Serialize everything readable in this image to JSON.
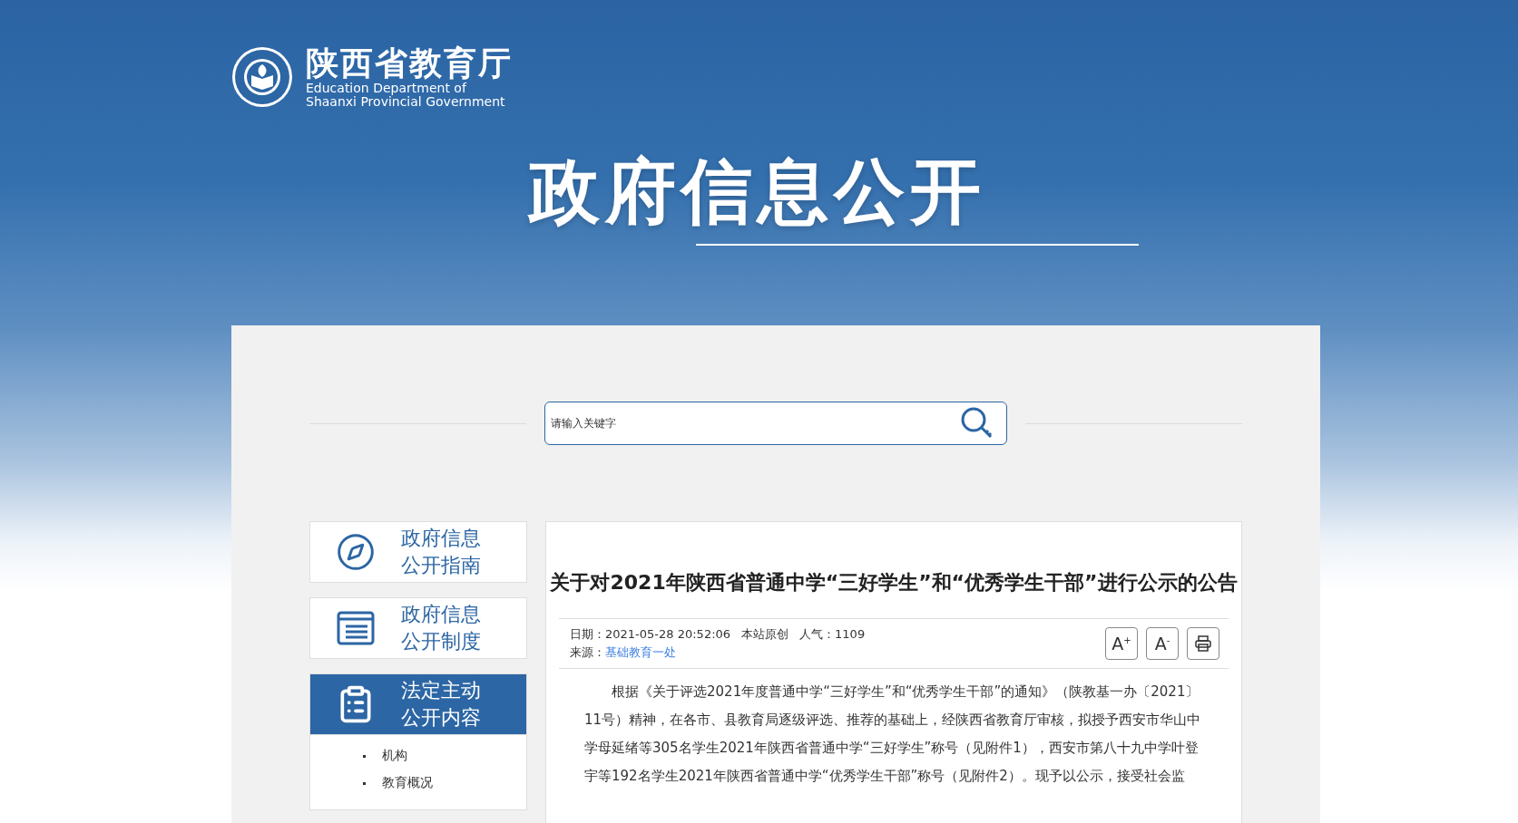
{
  "site": {
    "name": "陕西省教育厅",
    "name_en": [
      "Education Department of",
      "Shaanxi Provincial Government"
    ]
  },
  "banner_title": "政府信息公开",
  "search": {
    "placeholder": "请输入关键字"
  },
  "sidebar": {
    "items": [
      {
        "label": "政府信息公开指南",
        "kind": "compass",
        "selected": false
      },
      {
        "label": "政府信息公开制度",
        "kind": "list",
        "selected": false
      },
      {
        "label": "法定主动公开内容",
        "kind": "clipboard",
        "selected": true
      }
    ],
    "subitems": [
      "机构",
      "教育概况"
    ]
  },
  "article": {
    "title": "关于对2021年陕西省普通中学“三好学生”和“优秀学生干部”进行公示的公告",
    "meta": {
      "date_label": "日期：",
      "date": "2021-05-28 20:52:06",
      "origin": "本站原创",
      "views_label": "人气：",
      "views": "1109",
      "source_label": "来源：",
      "source": "基础教育一处"
    },
    "tools": [
      {
        "kind": "font",
        "label": "A$^{+}$"
      },
      {
        "kind": "font",
        "label": "A$^{-}$"
      },
      {
        "kind": "print"
      }
    ],
    "body": "根据《关于评选2021年度普通中学“三好学生”和“优秀学生干部”的通知》（陕教基一办〔2021〕11号）精神，在各市、县教育局逐级评选、推荐的基础上，经陕西省教育厅审核，拟授予西安市华山中学母延绪等305名学生2021年陕西省普通中学“三好学生”称号（见附件1），西安市第八十九中学叶登宇等192名学生2021年陕西省普通中学“优秀学生干部”称号（见附件2）。现予以公示，接受社会监"
  }
}
